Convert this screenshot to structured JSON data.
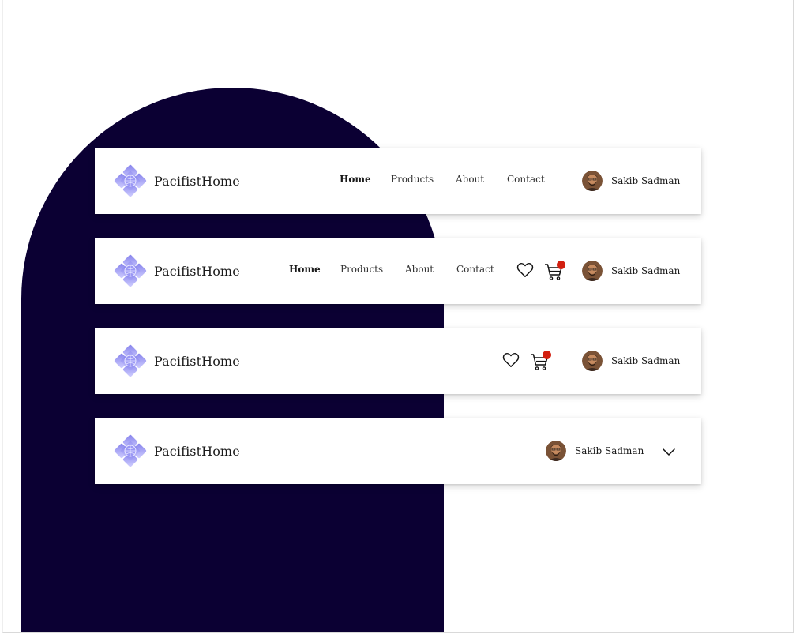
{
  "brand": {
    "name": "PacifistHome",
    "logo_icon": "lotus-logo-icon"
  },
  "nav": {
    "home": "Home",
    "products": "Products",
    "about": "About",
    "contact": "Contact"
  },
  "user": {
    "name": "Sakib Sadman",
    "avatar_icon": "avatar-photo"
  },
  "icons": {
    "wishlist": "heart-icon",
    "cart": "cart-icon",
    "menu": "chevron-down-icon"
  },
  "colors": {
    "background_shape": "#0b0033",
    "badge": "#d21f0f",
    "logo": "#8e8cf0"
  }
}
